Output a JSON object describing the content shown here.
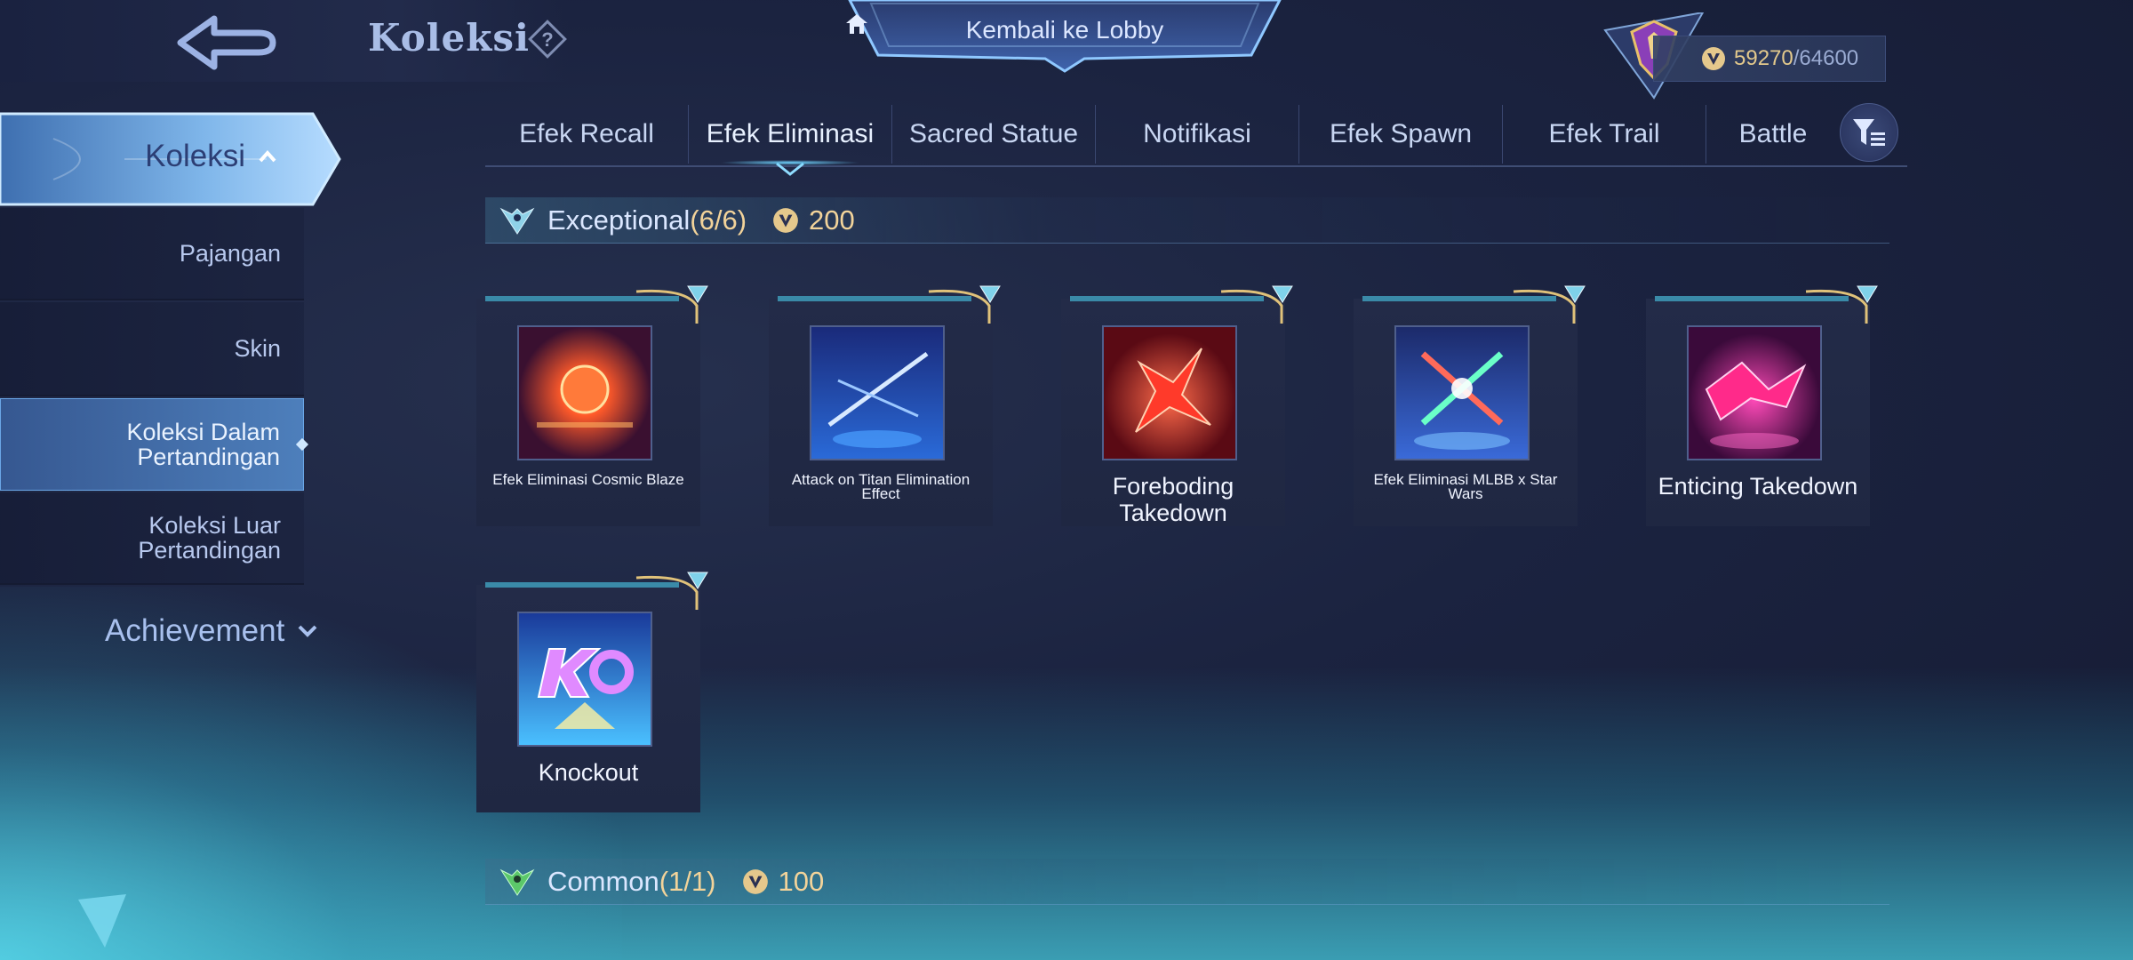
{
  "header": {
    "title": "Koleksi",
    "lobby_label": "Kembali ke Lobby",
    "points_current": "59270",
    "points_max": "/64600"
  },
  "sidebar": {
    "main_label": "Koleksi",
    "items": [
      {
        "label": "Pajangan"
      },
      {
        "label": "Skin"
      },
      {
        "label": "Koleksi Dalam Pertandingan"
      },
      {
        "label": "Koleksi Luar Pertandingan"
      }
    ],
    "achievement_label": "Achievement"
  },
  "tabs": [
    {
      "label": "Efek Recall"
    },
    {
      "label": "Efek Eliminasi"
    },
    {
      "label": "Sacred Statue"
    },
    {
      "label": "Notifikasi"
    },
    {
      "label": "Efek Spawn"
    },
    {
      "label": "Efek Trail"
    },
    {
      "label": "Battle"
    }
  ],
  "sections": {
    "exceptional": {
      "title": "Exceptional",
      "count": "(6/6)",
      "cost": "200"
    },
    "common": {
      "title": "Common",
      "count": "(1/1)",
      "cost": "100"
    }
  },
  "items": [
    {
      "name": "Efek Eliminasi Cosmic Blaze",
      "icon": "cosmic-blaze-icon"
    },
    {
      "name": "Attack on Titan Elimination Effect",
      "icon": "attack-on-titan-icon"
    },
    {
      "name": "Foreboding Takedown",
      "icon": "foreboding-takedown-icon"
    },
    {
      "name": "Efek Eliminasi MLBB x Star Wars",
      "icon": "star-wars-icon"
    },
    {
      "name": "Enticing Takedown",
      "icon": "enticing-takedown-icon"
    },
    {
      "name": "Knockout",
      "icon": "knockout-icon"
    }
  ],
  "colors": {
    "accent_gold": "#f2d39a",
    "accent_blue": "#6fd4ff",
    "background": "#1b2340"
  }
}
